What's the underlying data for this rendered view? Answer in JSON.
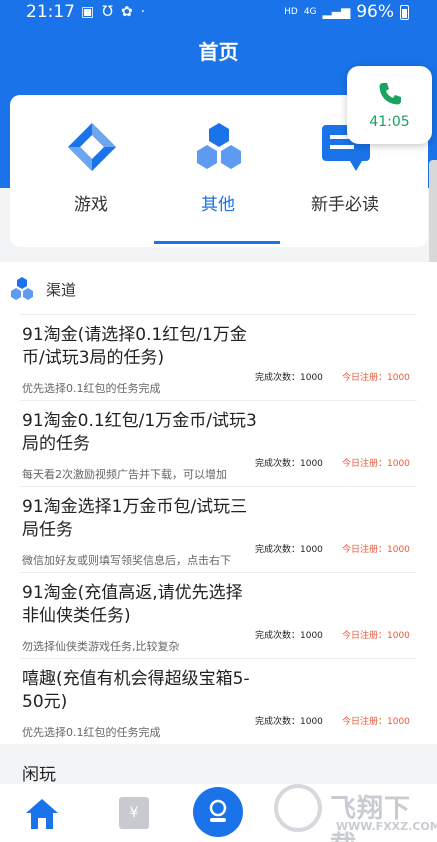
{
  "status_bar": {
    "time": "21:17",
    "network_hd": "HD",
    "network_4g": "4G",
    "battery_pct": "96%"
  },
  "header": {
    "title": "首页"
  },
  "call_bubble": {
    "timer": "41:05",
    "icon": "phone-icon",
    "color": "#1aa260"
  },
  "tabs": [
    {
      "label": "游戏",
      "icon": "game-diamond-icon",
      "active": false
    },
    {
      "label": "其他",
      "icon": "hexagon-cluster-icon",
      "active": true
    },
    {
      "label": "新手必读",
      "icon": "message-bubble-icon",
      "active": false
    }
  ],
  "section": {
    "label": "渠道",
    "icon": "hexagon-cluster-icon"
  },
  "tasks": [
    {
      "title": "91淘金(请选择0.1红包/1万金币/试玩3局的任务)",
      "desc": "优先选择0.1红包的任务完成",
      "done": "完成次数：1000",
      "today": "今日注册：1000"
    },
    {
      "title": "91淘金0.1红包/1万金币/试玩3局的任务",
      "desc": "每天看2次激励视频广告并下载，可以增加",
      "done": "完成次数：1000",
      "today": "今日注册：1000"
    },
    {
      "title": "91淘金选择1万金币包/试玩三局任务",
      "desc": "微信加好友或则填写领奖信息后，点击右下",
      "done": "完成次数：1000",
      "today": "今日注册：1000"
    },
    {
      "title": "91淘金(充值高返,请优先选择非仙侠类任务)",
      "desc": "勿选择仙侠类游戏任务,比较复杂",
      "done": "完成次数：1000",
      "today": "今日注册：1000"
    },
    {
      "title": "嘻趣(充值有机会得超级宝箱5-50元)",
      "desc": "优先选择0.1红包的任务完成",
      "done": "完成次数：1000",
      "today": "今日注册：1000"
    }
  ],
  "partial_item": {
    "title": "闲玩"
  },
  "bottom_nav": {
    "home_icon": "home-icon",
    "wallet_icon": "wallet-icon",
    "wallet_glyph": "¥",
    "center_icon": "profile-icon"
  },
  "watermark": {
    "brand": "飞翔下载",
    "url": "WWW.FXXZ.COM"
  },
  "colors": {
    "primary": "#1a73e8",
    "accent_red": "#e8583a"
  }
}
